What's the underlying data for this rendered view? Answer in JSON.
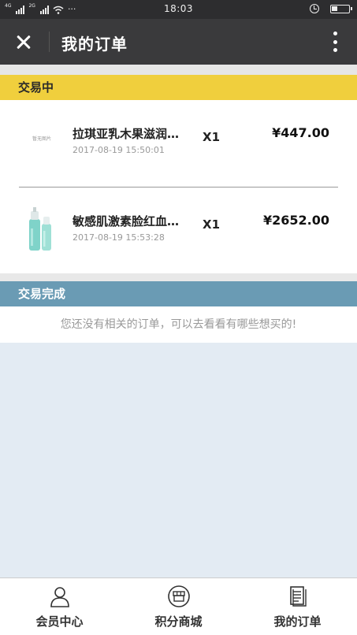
{
  "status_bar": {
    "network_1": "4G",
    "network_2": "2G",
    "more": "···",
    "time": "18:03"
  },
  "nav": {
    "title": "我的订单"
  },
  "sections": {
    "trading": "交易中",
    "completed": "交易完成"
  },
  "orders": [
    {
      "thumb_text": "暂无图片",
      "name": "拉琪亚乳木果滋润…",
      "time": "2017-08-19 15:50:01",
      "qty": "X1",
      "price": "¥447.00"
    },
    {
      "thumb_text": "",
      "name": "敏感肌激素脸红血…",
      "time": "2017-08-19 15:53:28",
      "qty": "X1",
      "price": "¥2652.00"
    }
  ],
  "completed_empty_text": "您还没有相关的订单，可以去看看有哪些想买的!",
  "tabs": [
    {
      "label": "会员中心",
      "icon": "user-icon"
    },
    {
      "label": "积分商城",
      "icon": "shop-icon"
    },
    {
      "label": "我的订单",
      "icon": "orders-icon"
    }
  ],
  "colors": {
    "trading_header": "#f0cf3d",
    "completed_header": "#6a9bb4",
    "nav_bar": "#3a3a3c"
  }
}
